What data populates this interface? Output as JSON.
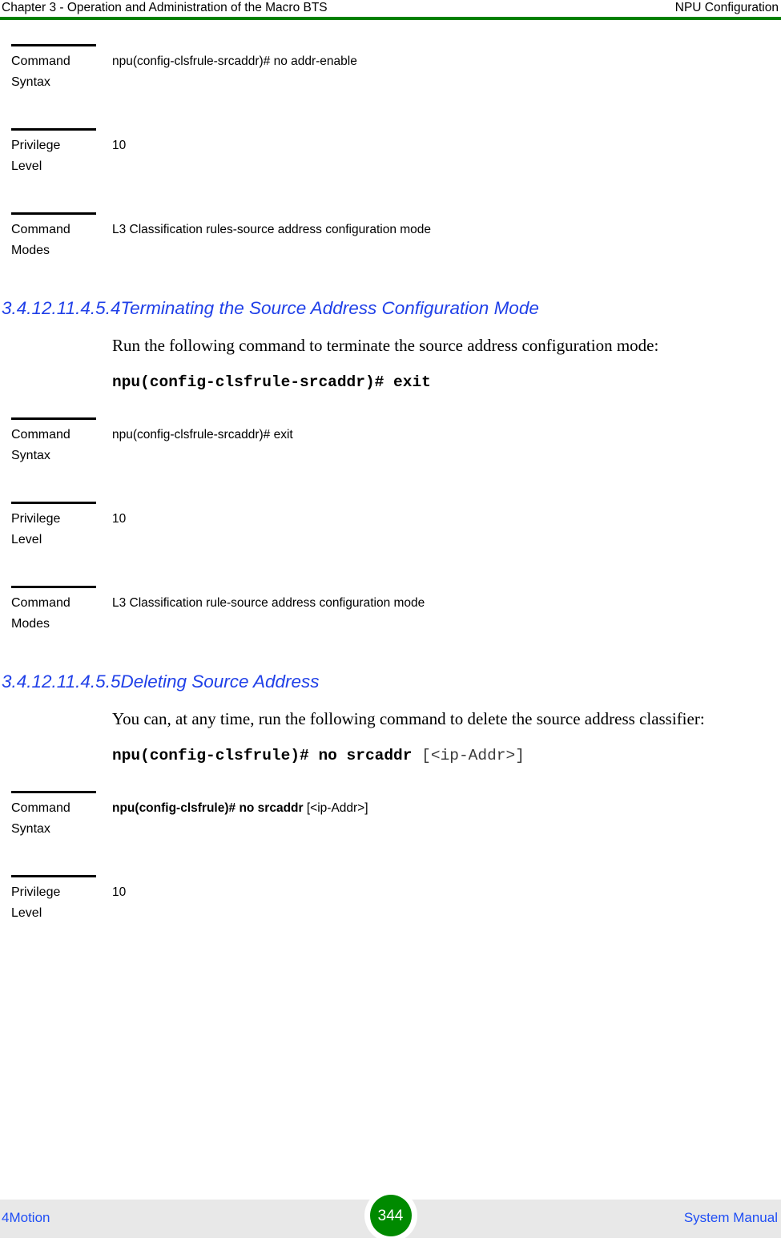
{
  "header": {
    "left": "Chapter 3 - Operation and Administration of the Macro BTS",
    "right": "NPU Configuration",
    "rule_color": "#008000"
  },
  "footer": {
    "left": "4Motion",
    "right": "System Manual",
    "page_number": "344",
    "badge_color": "#008a00",
    "bar_color": "#e8e8e8",
    "link_color": "#1f4ef5"
  },
  "blocks": [
    {
      "type": "spec_table",
      "name": "no-addr-enable-spec",
      "rows": [
        {
          "label_line1": "Command",
          "label_line2": "Syntax",
          "value": "npu(config-clsfrule-srcaddr)# no addr-enable",
          "value_bold": "",
          "value_optional": ""
        },
        {
          "label_line1": "Privilege",
          "label_line2": "Level",
          "value": "10",
          "value_bold": "",
          "value_optional": ""
        },
        {
          "label_line1": "Command",
          "label_line2": "Modes",
          "value": "L3 Classification rules-source address configuration mode",
          "value_bold": "",
          "value_optional": ""
        }
      ]
    },
    {
      "type": "heading",
      "number": "3.4.12.11.4.5.4",
      "title": "Terminating the Source Address Configuration Mode",
      "color": "#2040e8"
    },
    {
      "type": "paragraph",
      "text": "Run the following command to terminate the source address configuration mode:"
    },
    {
      "type": "cli",
      "bold": "npu(config-clsfrule-srcaddr)# exit",
      "optional": ""
    },
    {
      "type": "spec_table",
      "name": "exit-spec",
      "rows": [
        {
          "label_line1": "Command",
          "label_line2": "Syntax",
          "value": "npu(config-clsfrule-srcaddr)# exit",
          "value_bold": "",
          "value_optional": ""
        },
        {
          "label_line1": "Privilege",
          "label_line2": "Level",
          "value": "10",
          "value_bold": "",
          "value_optional": ""
        },
        {
          "label_line1": "Command",
          "label_line2": "Modes",
          "value": "L3 Classification rule-source address configuration mode",
          "value_bold": "",
          "value_optional": ""
        }
      ]
    },
    {
      "type": "heading",
      "number": "3.4.12.11.4.5.5",
      "title": "Deleting Source Address",
      "color": "#2040e8"
    },
    {
      "type": "paragraph",
      "text": "You can, at any time, run the following command to delete the source address classifier:"
    },
    {
      "type": "cli",
      "bold": "npu(config-clsfrule)# no srcaddr ",
      "optional": "[<ip-Addr>]"
    },
    {
      "type": "spec_table",
      "name": "no-srcaddr-spec",
      "rows": [
        {
          "label_line1": "Command",
          "label_line2": "Syntax",
          "value": "",
          "value_bold": "npu(config-clsfrule)# no srcaddr ",
          "value_optional": "[<ip-Addr>]"
        },
        {
          "label_line1": "Privilege",
          "label_line2": "Level",
          "value": "10",
          "value_bold": "",
          "value_optional": ""
        }
      ]
    }
  ]
}
